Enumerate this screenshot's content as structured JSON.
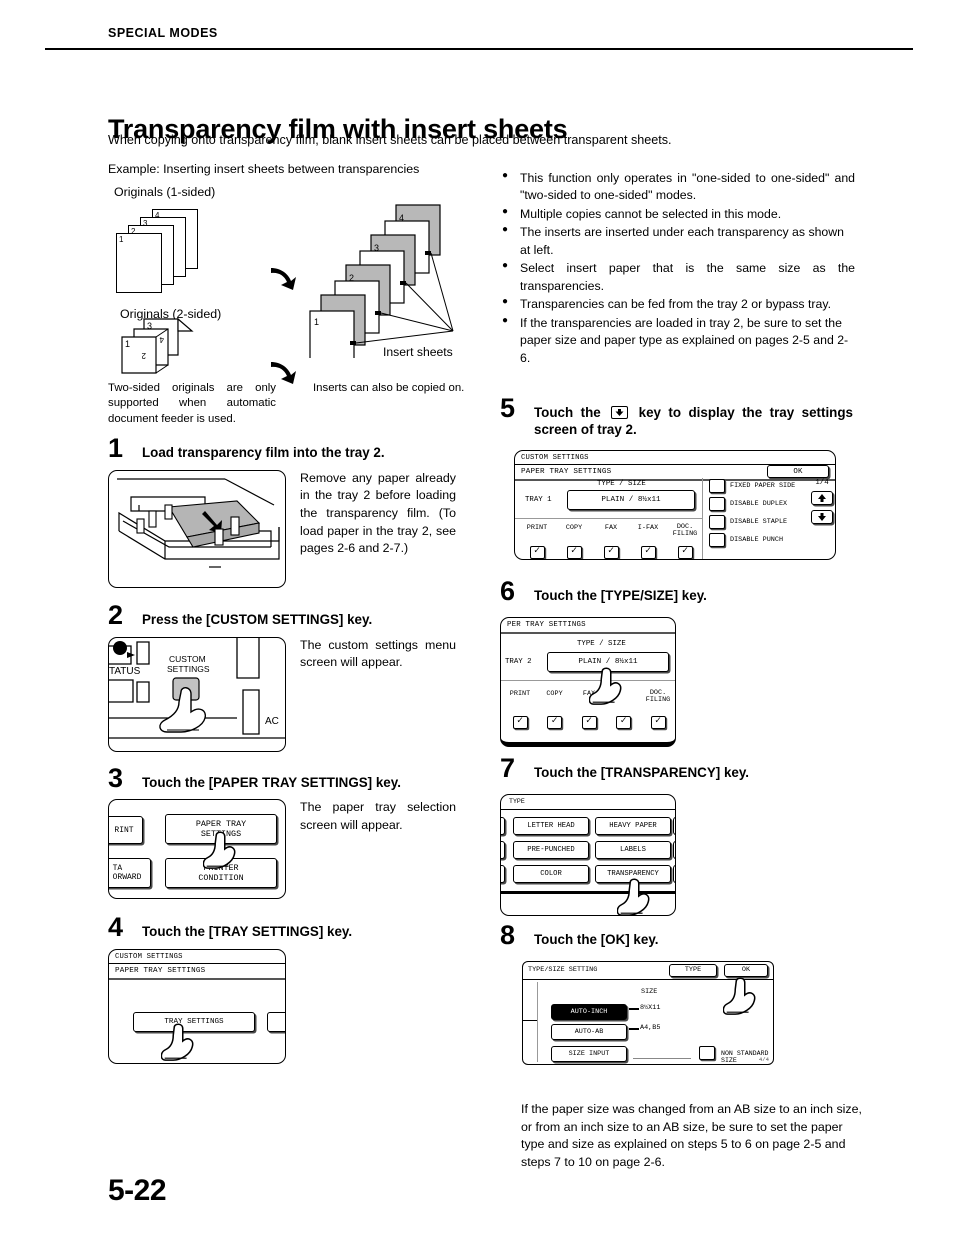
{
  "running_head": "SPECIAL MODES",
  "title": "Transparency film with insert sheets",
  "subtitle": "When copying onto transparency film, blank insert sheets can be placed between transparent sheets.",
  "illustration": {
    "example_caption": "Example: Inserting insert sheets between transparencies",
    "originals_1sided_label": "Originals (1-sided)",
    "originals_2sided_label": "Originals (2-sided)",
    "insert_sheets_label": "Insert sheets",
    "note_left": "Two-sided originals are only supported when automatic document feeder is used.",
    "note_right": "Inserts can also be copied on.",
    "sheet_numbers": [
      "1",
      "2",
      "3",
      "4"
    ],
    "twosided_numbers": [
      "1",
      "2",
      "3",
      "4"
    ]
  },
  "bullets": [
    "This function only operates in \"one-sided to one-sided\" and \"two-sided to one-sided\" modes.",
    "Multiple copies cannot be selected in this mode.",
    "The inserts are inserted under each transparency as shown at left.",
    "Select insert paper that is the same size as the transparencies.",
    "Transparencies can be fed from the tray 2 or bypass tray.",
    "If the transparencies are loaded in tray 2, be sure to set the paper size and paper type as explained on pages 2-5 and 2-6."
  ],
  "steps": {
    "s1": {
      "num": "1",
      "heading": "Load transparency film into the tray 2.",
      "text": "Remove any paper already in the tray 2 before loading the transparency film. (To load paper in the tray 2, see pages 2-6 and 2-7.)"
    },
    "s2": {
      "num": "2",
      "heading": "Press the [CUSTOM SETTINGS] key.",
      "text": "The custom settings menu screen will appear.",
      "panel": {
        "status_label": "TATUS",
        "custom_settings_label_line1": "CUSTOM",
        "custom_settings_label_line2": "SETTINGS",
        "ac_label": "AC"
      }
    },
    "s3": {
      "num": "3",
      "heading": "Touch the [PAPER TRAY SETTINGS] key.",
      "text": "The paper tray selection screen will appear.",
      "panel": {
        "print_key": "RINT",
        "paper_tray_settings_line1": "PAPER TRAY",
        "paper_tray_settings_line2": "SETTINGS",
        "data_forward_line1": "TA",
        "data_forward_line2": "ORWARD",
        "printer_condition_line1": "PRINTER",
        "printer_condition_line2": "CONDITION"
      }
    },
    "s4": {
      "num": "4",
      "heading": "Touch the [TRAY SETTINGS] key.",
      "panel": {
        "title": "CUSTOM SETTINGS",
        "subtitle": "PAPER TRAY SETTINGS",
        "tray_settings_key": "TRAY SETTINGS"
      }
    },
    "s5": {
      "num": "5",
      "heading_before": "Touch the",
      "heading_icon": "down-arrow-key-icon",
      "heading_after": "key to display the tray settings screen of tray 2.",
      "panel": {
        "title": "CUSTOM SETTINGS",
        "subtitle": "PAPER TRAY SETTINGS",
        "ok_key": "OK",
        "type_size_label": "TYPE / SIZE",
        "tray_label": "TRAY 1",
        "type_size_value": "PLAIN / 8½x11",
        "function_labels": [
          "PRINT",
          "COPY",
          "FAX",
          "I-FAX",
          "DOC. FILING"
        ],
        "function_checked": [
          true,
          true,
          true,
          true,
          true
        ],
        "options": [
          "FIXED PAPER SIDE",
          "DISABLE DUPLEX",
          "DISABLE STAPLE",
          "DISABLE PUNCH"
        ],
        "option_checked": [
          false,
          false,
          false,
          false
        ],
        "page_indicator": "1/4",
        "up_key": "up-arrow-key-icon",
        "down_key": "down-arrow-key-icon"
      }
    },
    "s6": {
      "num": "6",
      "heading": "Touch the [TYPE/SIZE] key.",
      "panel": {
        "subtitle": "PER TRAY SETTINGS",
        "type_size_label": "TYPE / SIZE",
        "tray_label": "TRAY 2",
        "type_size_value": "PLAIN / 8½x11",
        "function_labels": [
          "PRINT",
          "COPY",
          "FAX",
          "",
          "DOC. FILING"
        ],
        "function_checked": [
          true,
          true,
          true,
          true,
          true
        ]
      }
    },
    "s7": {
      "num": "7",
      "heading": "Touch the [TRANSPARENCY] key.",
      "panel": {
        "subtitle": "TYPE",
        "keys": [
          "LETTER HEAD",
          "HEAVY PAPER",
          "PRE-PUNCHED",
          "LABELS",
          "COLOR",
          "TRANSPARENCY"
        ]
      }
    },
    "s8": {
      "num": "8",
      "heading": "Touch the [OK] key.",
      "panel": {
        "title": "TYPE/SIZE SETTING",
        "type_key": "TYPE",
        "ok_key": "OK",
        "size_label": "SIZE",
        "auto_inch_key": "AUTO-INCH",
        "auto_inch_value": "8½X11",
        "auto_ab_key": "AUTO-AB",
        "auto_ab_value": "A4,B5",
        "size_input_key": "SIZE INPUT",
        "non_standard_label": "NON STANDARD SIZE",
        "page_indicator": "4/4"
      }
    }
  },
  "bottom_note": "If the paper size was changed from an AB size to an inch size, or from an inch size to an AB size, be sure to set the paper type and size as explained on steps 5 to 6 on page 2-5 and steps 7 to 10 on page 2-6.",
  "folio": "5-22"
}
